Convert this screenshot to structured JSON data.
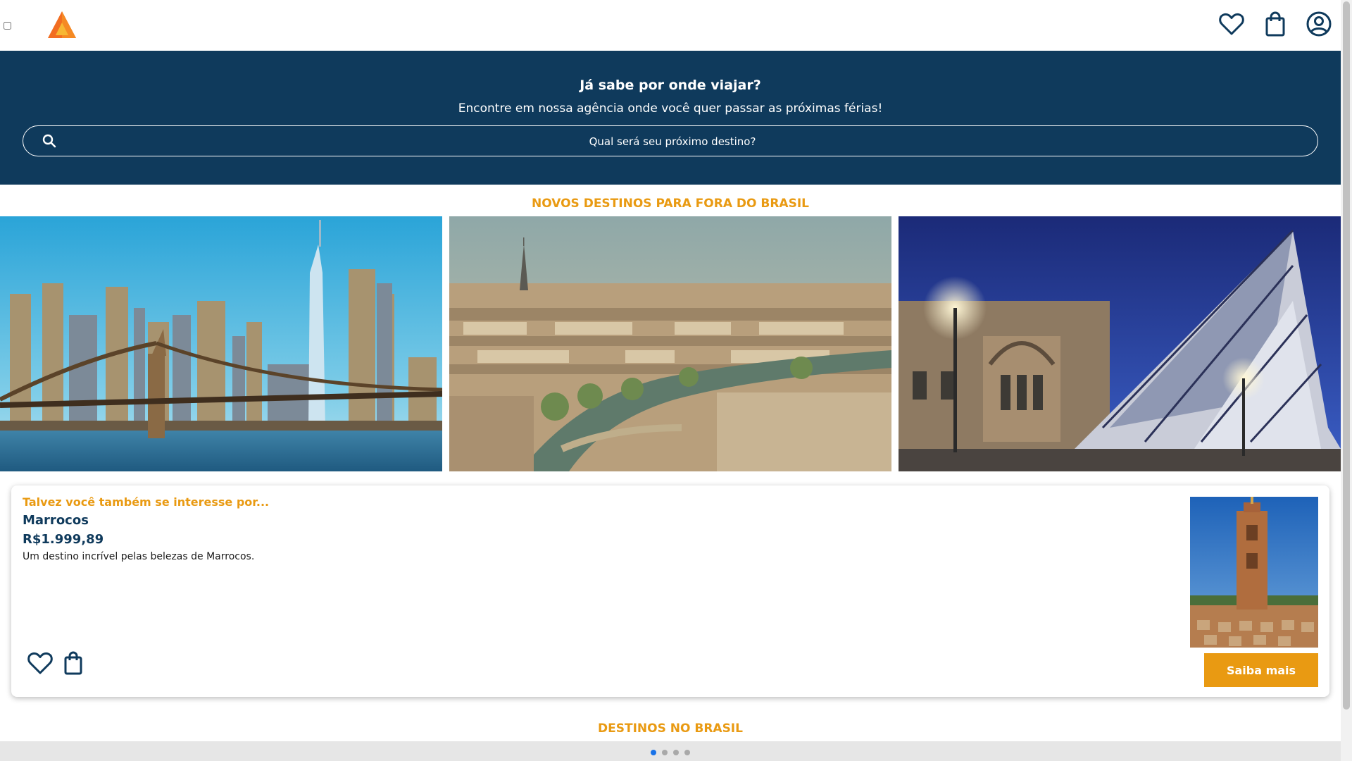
{
  "header": {
    "menu_toggle_checked": false,
    "icons": [
      "logo-triangle",
      "heart-icon",
      "shopping-bag-icon",
      "user-circle-icon"
    ]
  },
  "hero": {
    "title": "Já sabe por onde viajar?",
    "subtitle": "Encontre em nossa agência onde você quer passar as próximas férias!",
    "search_placeholder": "Qual será seu próximo destino?"
  },
  "international": {
    "title": "NOVOS DESTINOS PARA FORA DO BRASIL",
    "photos": [
      "new-york-skyline",
      "paris-cityscape",
      "toronto-museum"
    ]
  },
  "recommendation": {
    "kicker": "Talvez você também se interesse por...",
    "destination": "Marrocos",
    "price": "R$1.999,89",
    "description": "Um destino incrível pelas belezas de Marrocos.",
    "button_label": "Saiba mais",
    "photo": "marrakech-minaret"
  },
  "domestic": {
    "title": "DESTINOS NO BRASIL"
  },
  "carousel": {
    "dots": 4,
    "active_index": 0
  },
  "colors": {
    "navy": "#0f3a5c",
    "accent": "#e99a12",
    "active_dot": "#1a73e8"
  }
}
